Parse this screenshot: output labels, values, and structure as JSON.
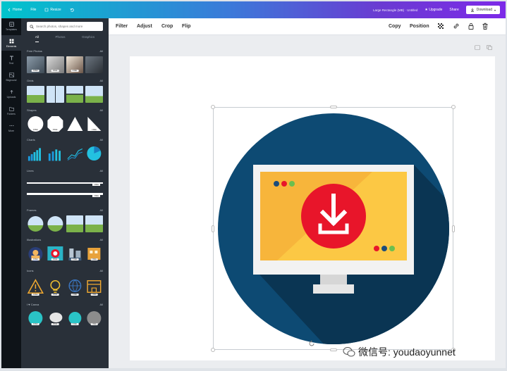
{
  "topbar": {
    "home": "Home",
    "file": "File",
    "resize": "Resize",
    "doc_name": "Large Rectangle (MB) · Untitled",
    "upgrade": "Upgrade",
    "share": "Share",
    "download": "Download",
    "gradient_start": "#00c4cc",
    "gradient_end": "#7d2ae8"
  },
  "rail": {
    "items": [
      "Templates",
      "Elements",
      "Text",
      "Bkground",
      "Uploads",
      "Folders",
      "More"
    ]
  },
  "panel": {
    "search_placeholder": "Search photos, shapes and more",
    "tabs": [
      "All",
      "Photos",
      "Graphics"
    ],
    "sections": [
      {
        "title": "Free Photos",
        "see_all": "All"
      },
      {
        "title": "Grids",
        "see_all": "All"
      },
      {
        "title": "Shapes",
        "see_all": "All"
      },
      {
        "title": "Charts",
        "see_all": "All"
      },
      {
        "title": "Lines",
        "see_all": "All"
      },
      {
        "title": "Frames",
        "see_all": "All"
      },
      {
        "title": "Illustrations",
        "see_all": "All"
      },
      {
        "title": "Icons",
        "see_all": "All"
      },
      {
        "title": "I ♥ Canva",
        "see_all": "All"
      }
    ],
    "badge": "FREE"
  },
  "toolbar": {
    "filter": "Filter",
    "adjust": "Adjust",
    "crop": "Crop",
    "flip": "Flip",
    "copy": "Copy",
    "position": "Position"
  },
  "artwork": {
    "circle_color": "#0d4a73",
    "shadow_color": "#0a3553",
    "monitor_color": "#f2f2f2",
    "screen_color": "#fcc844",
    "screen_alt_color": "#f7b53b",
    "button_color": "#e8152a",
    "dot_colors": [
      "#1d4d7a",
      "#e8152a",
      "#6cbf4e"
    ]
  },
  "watermark": {
    "text": "微信号: youdaoyunnet"
  }
}
